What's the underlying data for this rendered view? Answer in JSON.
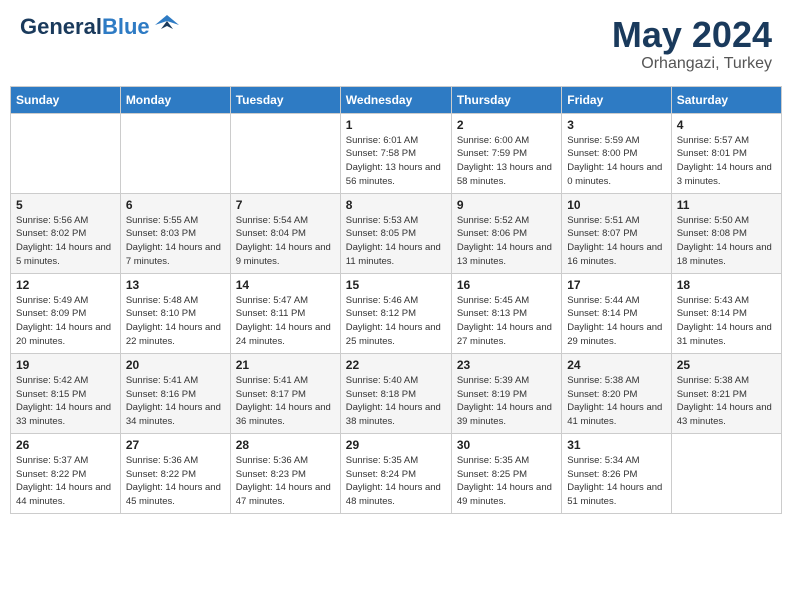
{
  "header": {
    "logo_line1": "General",
    "logo_line2": "Blue",
    "title": "May 2024",
    "location": "Orhangazi, Turkey"
  },
  "days_of_week": [
    "Sunday",
    "Monday",
    "Tuesday",
    "Wednesday",
    "Thursday",
    "Friday",
    "Saturday"
  ],
  "weeks": [
    [
      {
        "num": "",
        "sunrise": "",
        "sunset": "",
        "daylight": ""
      },
      {
        "num": "",
        "sunrise": "",
        "sunset": "",
        "daylight": ""
      },
      {
        "num": "",
        "sunrise": "",
        "sunset": "",
        "daylight": ""
      },
      {
        "num": "1",
        "sunrise": "Sunrise: 6:01 AM",
        "sunset": "Sunset: 7:58 PM",
        "daylight": "Daylight: 13 hours and 56 minutes."
      },
      {
        "num": "2",
        "sunrise": "Sunrise: 6:00 AM",
        "sunset": "Sunset: 7:59 PM",
        "daylight": "Daylight: 13 hours and 58 minutes."
      },
      {
        "num": "3",
        "sunrise": "Sunrise: 5:59 AM",
        "sunset": "Sunset: 8:00 PM",
        "daylight": "Daylight: 14 hours and 0 minutes."
      },
      {
        "num": "4",
        "sunrise": "Sunrise: 5:57 AM",
        "sunset": "Sunset: 8:01 PM",
        "daylight": "Daylight: 14 hours and 3 minutes."
      }
    ],
    [
      {
        "num": "5",
        "sunrise": "Sunrise: 5:56 AM",
        "sunset": "Sunset: 8:02 PM",
        "daylight": "Daylight: 14 hours and 5 minutes."
      },
      {
        "num": "6",
        "sunrise": "Sunrise: 5:55 AM",
        "sunset": "Sunset: 8:03 PM",
        "daylight": "Daylight: 14 hours and 7 minutes."
      },
      {
        "num": "7",
        "sunrise": "Sunrise: 5:54 AM",
        "sunset": "Sunset: 8:04 PM",
        "daylight": "Daylight: 14 hours and 9 minutes."
      },
      {
        "num": "8",
        "sunrise": "Sunrise: 5:53 AM",
        "sunset": "Sunset: 8:05 PM",
        "daylight": "Daylight: 14 hours and 11 minutes."
      },
      {
        "num": "9",
        "sunrise": "Sunrise: 5:52 AM",
        "sunset": "Sunset: 8:06 PM",
        "daylight": "Daylight: 14 hours and 13 minutes."
      },
      {
        "num": "10",
        "sunrise": "Sunrise: 5:51 AM",
        "sunset": "Sunset: 8:07 PM",
        "daylight": "Daylight: 14 hours and 16 minutes."
      },
      {
        "num": "11",
        "sunrise": "Sunrise: 5:50 AM",
        "sunset": "Sunset: 8:08 PM",
        "daylight": "Daylight: 14 hours and 18 minutes."
      }
    ],
    [
      {
        "num": "12",
        "sunrise": "Sunrise: 5:49 AM",
        "sunset": "Sunset: 8:09 PM",
        "daylight": "Daylight: 14 hours and 20 minutes."
      },
      {
        "num": "13",
        "sunrise": "Sunrise: 5:48 AM",
        "sunset": "Sunset: 8:10 PM",
        "daylight": "Daylight: 14 hours and 22 minutes."
      },
      {
        "num": "14",
        "sunrise": "Sunrise: 5:47 AM",
        "sunset": "Sunset: 8:11 PM",
        "daylight": "Daylight: 14 hours and 24 minutes."
      },
      {
        "num": "15",
        "sunrise": "Sunrise: 5:46 AM",
        "sunset": "Sunset: 8:12 PM",
        "daylight": "Daylight: 14 hours and 25 minutes."
      },
      {
        "num": "16",
        "sunrise": "Sunrise: 5:45 AM",
        "sunset": "Sunset: 8:13 PM",
        "daylight": "Daylight: 14 hours and 27 minutes."
      },
      {
        "num": "17",
        "sunrise": "Sunrise: 5:44 AM",
        "sunset": "Sunset: 8:14 PM",
        "daylight": "Daylight: 14 hours and 29 minutes."
      },
      {
        "num": "18",
        "sunrise": "Sunrise: 5:43 AM",
        "sunset": "Sunset: 8:14 PM",
        "daylight": "Daylight: 14 hours and 31 minutes."
      }
    ],
    [
      {
        "num": "19",
        "sunrise": "Sunrise: 5:42 AM",
        "sunset": "Sunset: 8:15 PM",
        "daylight": "Daylight: 14 hours and 33 minutes."
      },
      {
        "num": "20",
        "sunrise": "Sunrise: 5:41 AM",
        "sunset": "Sunset: 8:16 PM",
        "daylight": "Daylight: 14 hours and 34 minutes."
      },
      {
        "num": "21",
        "sunrise": "Sunrise: 5:41 AM",
        "sunset": "Sunset: 8:17 PM",
        "daylight": "Daylight: 14 hours and 36 minutes."
      },
      {
        "num": "22",
        "sunrise": "Sunrise: 5:40 AM",
        "sunset": "Sunset: 8:18 PM",
        "daylight": "Daylight: 14 hours and 38 minutes."
      },
      {
        "num": "23",
        "sunrise": "Sunrise: 5:39 AM",
        "sunset": "Sunset: 8:19 PM",
        "daylight": "Daylight: 14 hours and 39 minutes."
      },
      {
        "num": "24",
        "sunrise": "Sunrise: 5:38 AM",
        "sunset": "Sunset: 8:20 PM",
        "daylight": "Daylight: 14 hours and 41 minutes."
      },
      {
        "num": "25",
        "sunrise": "Sunrise: 5:38 AM",
        "sunset": "Sunset: 8:21 PM",
        "daylight": "Daylight: 14 hours and 43 minutes."
      }
    ],
    [
      {
        "num": "26",
        "sunrise": "Sunrise: 5:37 AM",
        "sunset": "Sunset: 8:22 PM",
        "daylight": "Daylight: 14 hours and 44 minutes."
      },
      {
        "num": "27",
        "sunrise": "Sunrise: 5:36 AM",
        "sunset": "Sunset: 8:22 PM",
        "daylight": "Daylight: 14 hours and 45 minutes."
      },
      {
        "num": "28",
        "sunrise": "Sunrise: 5:36 AM",
        "sunset": "Sunset: 8:23 PM",
        "daylight": "Daylight: 14 hours and 47 minutes."
      },
      {
        "num": "29",
        "sunrise": "Sunrise: 5:35 AM",
        "sunset": "Sunset: 8:24 PM",
        "daylight": "Daylight: 14 hours and 48 minutes."
      },
      {
        "num": "30",
        "sunrise": "Sunrise: 5:35 AM",
        "sunset": "Sunset: 8:25 PM",
        "daylight": "Daylight: 14 hours and 49 minutes."
      },
      {
        "num": "31",
        "sunrise": "Sunrise: 5:34 AM",
        "sunset": "Sunset: 8:26 PM",
        "daylight": "Daylight: 14 hours and 51 minutes."
      },
      {
        "num": "",
        "sunrise": "",
        "sunset": "",
        "daylight": ""
      }
    ]
  ]
}
